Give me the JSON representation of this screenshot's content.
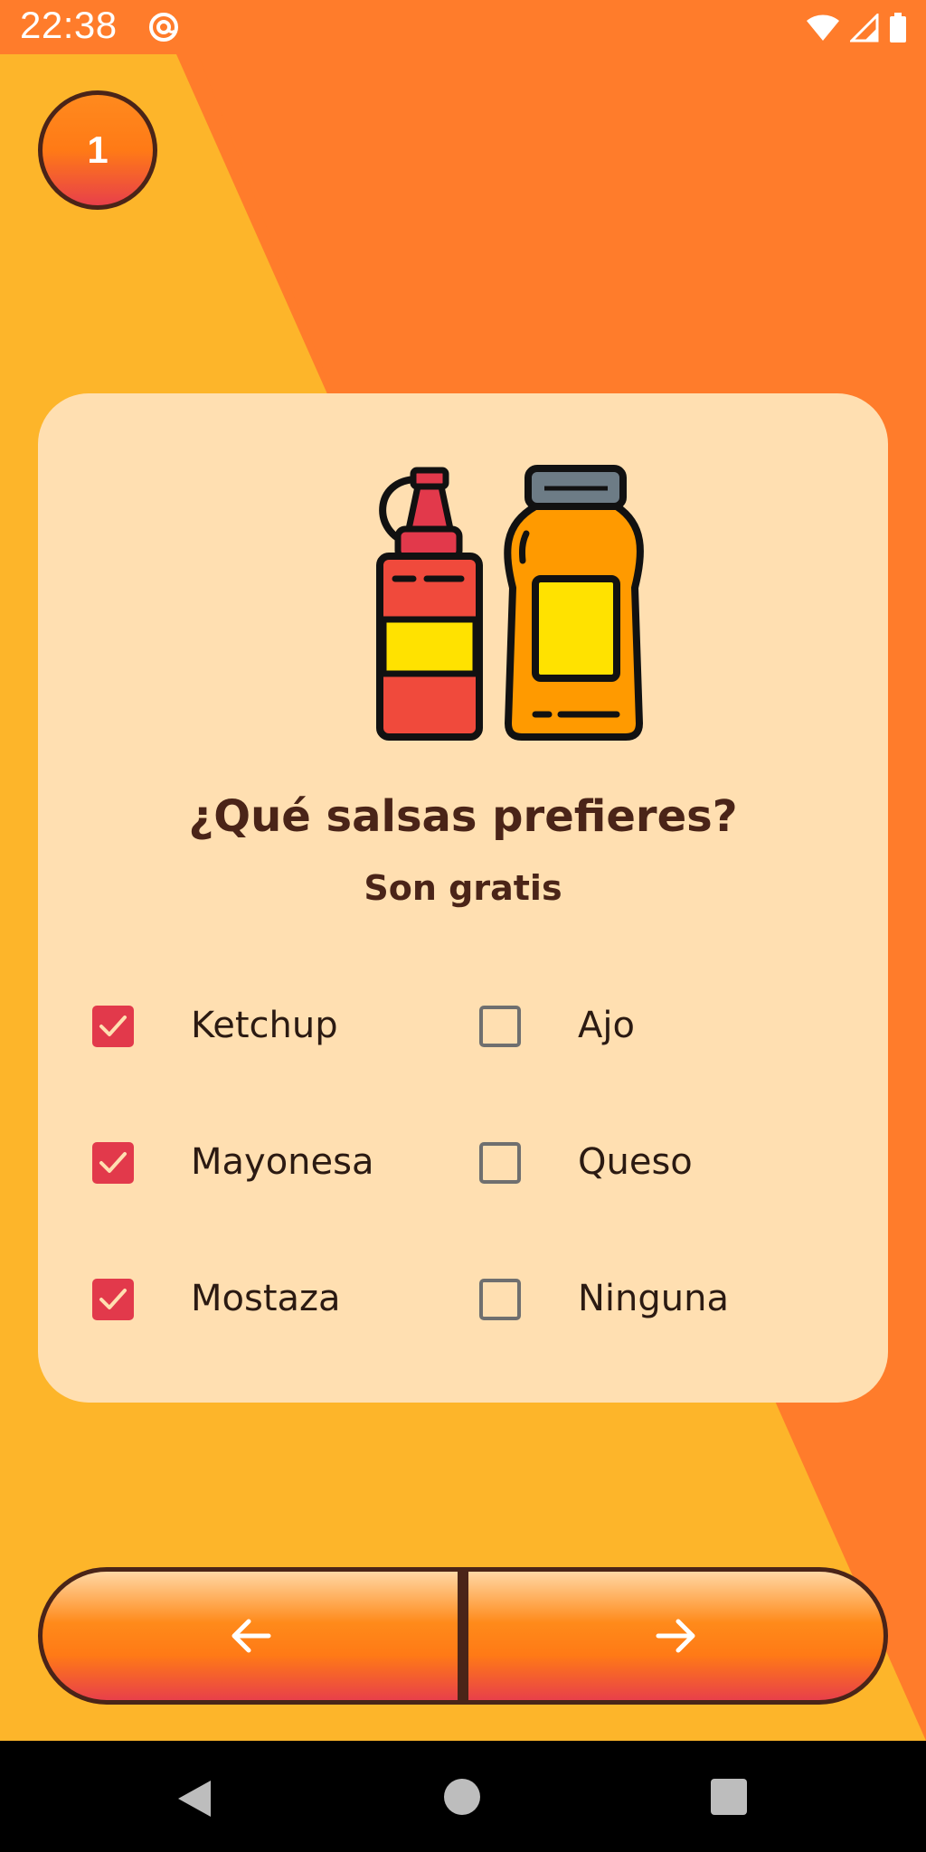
{
  "status_bar": {
    "time": "22:38",
    "icons": [
      "at-sign-icon",
      "wifi-icon",
      "cell-signal-icon",
      "battery-icon"
    ]
  },
  "step_badge": "1",
  "card": {
    "illustration": "sauce-bottles-icon",
    "title": "¿Qué salsas prefieres?",
    "subtitle": "Son gratis",
    "options": [
      {
        "label": "Ketchup",
        "checked": true
      },
      {
        "label": "Ajo",
        "checked": false
      },
      {
        "label": "Mayonesa",
        "checked": true
      },
      {
        "label": "Queso",
        "checked": false
      },
      {
        "label": "Mostaza",
        "checked": true
      },
      {
        "label": "Ninguna",
        "checked": false
      }
    ]
  },
  "navigation": {
    "back_icon": "arrow-left-icon",
    "next_icon": "arrow-right-icon"
  },
  "system_nav": [
    "back-triangle-icon",
    "home-circle-icon",
    "recents-square-icon"
  ],
  "colors": {
    "background_orange": "#ff7c2b",
    "background_yellow": "#fdb52a",
    "card": "#ffdfb1",
    "text_dark": "#4a2418",
    "checkbox_checked": "#e2394b"
  }
}
